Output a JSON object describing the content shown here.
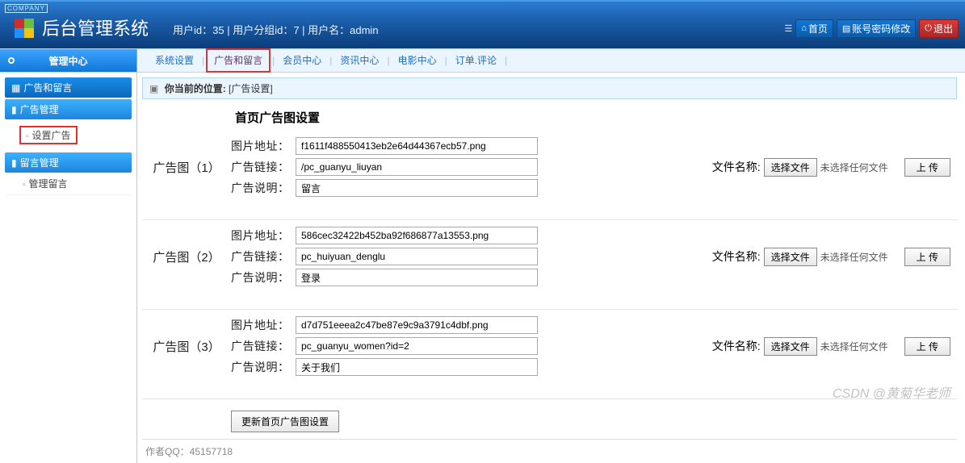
{
  "company_tag": "COMPANY",
  "app_title": "后台管理系统",
  "user_line": "用户id：35 | 用户分组id：7 | 用户名：admin",
  "header_buttons": {
    "home": "首页",
    "pwd": "账号密码修改",
    "logout": "退出"
  },
  "nav_title": "管理中心",
  "nav_items": [
    "系统设置",
    "广告和留言",
    "会员中心",
    "资讯中心",
    "电影中心",
    "订单.评论"
  ],
  "nav_active_index": 1,
  "sidebar": {
    "top": "广告和留言",
    "group1_label": "广告管理",
    "group1_item": "设置广告",
    "group2_label": "留言管理",
    "group2_item": "管理留言"
  },
  "crumb_label": "你当前的位置:",
  "crumb_value": "[广告设置]",
  "section_title": "首页广告图设置",
  "field_labels": {
    "img": "图片地址：",
    "link": "广告链接：",
    "desc": "广告说明：",
    "file": "文件名称:"
  },
  "file_button": "选择文件",
  "file_status": "未选择任何文件",
  "upload_button": "上 传",
  "submit_button": "更新首页广告图设置",
  "ads": [
    {
      "row_label": "广告图（1）",
      "img": "f1611f488550413eb2e64d44367ecb57.png",
      "link": "/pc_guanyu_liuyan",
      "desc": "留言"
    },
    {
      "row_label": "广告图（2）",
      "img": "586cec32422b452ba92f686877a13553.png",
      "link": "pc_huiyuan_denglu",
      "desc": "登录"
    },
    {
      "row_label": "广告图（3）",
      "img": "d7d751eeea2c47be87e9c9a3791c4dbf.png",
      "link": "pc_guanyu_women?id=2",
      "desc": "关于我们"
    }
  ],
  "footer": "作者QQ：45157718",
  "watermark": "CSDN @黄菊华老师"
}
